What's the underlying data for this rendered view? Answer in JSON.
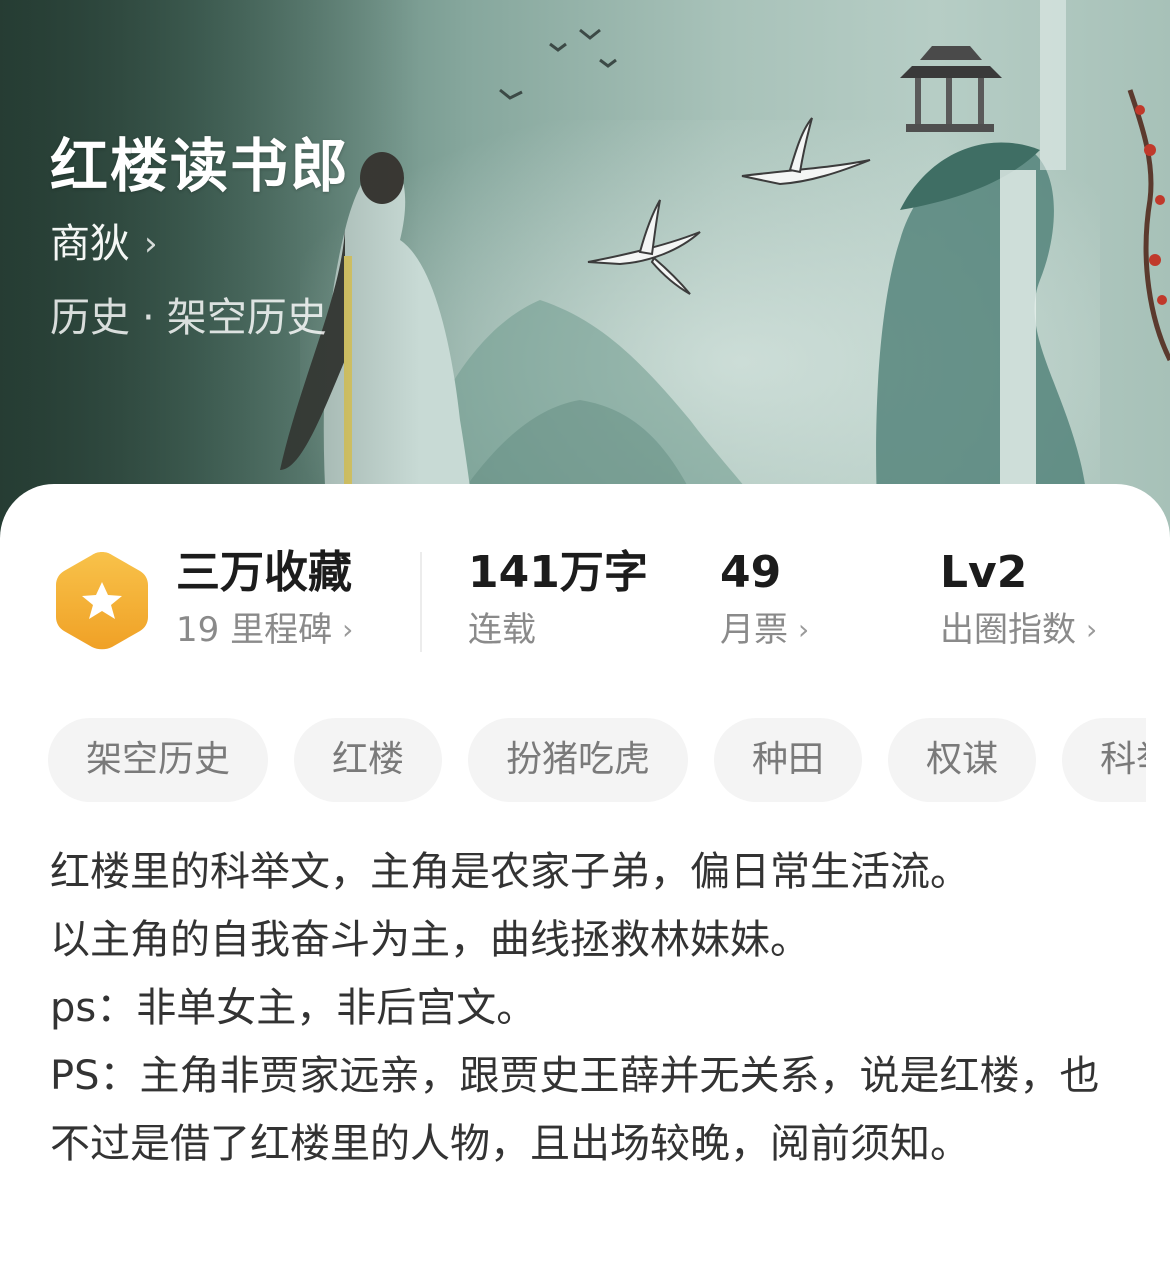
{
  "book": {
    "title": "红楼读书郎",
    "author": "商狄",
    "genre_main": "历史",
    "genre_sep": "·",
    "genre_sub": "架空历史"
  },
  "stats": {
    "collection": {
      "value": "三万收藏",
      "label": "19 里程碑"
    },
    "words": {
      "value": "141万字",
      "label": "连载"
    },
    "tickets": {
      "value": "49",
      "label": "月票"
    },
    "level": {
      "value": "Lv2",
      "label": "出圈指数"
    }
  },
  "tags": [
    "架空历史",
    "红楼",
    "扮猪吃虎",
    "种田",
    "权谋",
    "科举"
  ],
  "description": [
    "红楼里的科举文，主角是农家子弟，偏日常生活流。",
    "以主角的自我奋斗为主，曲线拯救林妹妹。",
    "ps：非单女主，非后宫文。",
    "PS：主角非贾家远亲，跟贾史王薛并无关系，说是红楼，也不过是借了红楼里的人物，且出场较晚，阅前须知。"
  ],
  "icons": {
    "badge": "star-hexagon-icon",
    "chevron": "chevron-right-icon"
  },
  "colors": {
    "badge_top": "#f8c24a",
    "badge_bottom": "#f0a126",
    "text_primary": "#1c1c1c",
    "text_secondary": "#8a8a8a",
    "tag_bg": "#f4f4f4"
  }
}
